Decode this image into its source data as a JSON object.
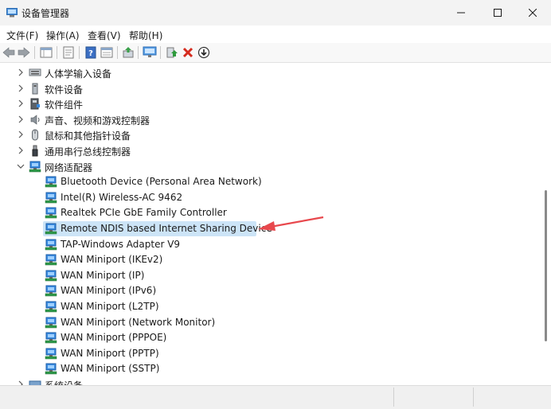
{
  "window": {
    "title": "设备管理器",
    "controls": [
      "minimize",
      "maximize",
      "close"
    ]
  },
  "menu": [
    {
      "label": "文件(F)"
    },
    {
      "label": "操作(A)"
    },
    {
      "label": "查看(V)"
    },
    {
      "label": "帮助(H)"
    }
  ],
  "toolbar": {
    "icons": [
      "back-arrow-icon",
      "forward-arrow-icon",
      "properties-grid-icon",
      "driver-doc-icon",
      "help-icon",
      "view-details-icon",
      "update-driver-icon",
      "monitor-scan-icon",
      "add-driver-icon",
      "uninstall-x-icon",
      "rollback-down-icon"
    ]
  },
  "tree": {
    "items": [
      {
        "label": "人体学输入设备",
        "level": 0,
        "expanded": false,
        "icon": "hid-icon"
      },
      {
        "label": "软件设备",
        "level": 0,
        "expanded": false,
        "icon": "software-device-icon"
      },
      {
        "label": "软件组件",
        "level": 0,
        "expanded": false,
        "icon": "software-component-icon"
      },
      {
        "label": "声音、视频和游戏控制器",
        "level": 0,
        "expanded": false,
        "icon": "speaker-icon"
      },
      {
        "label": "鼠标和其他指针设备",
        "level": 0,
        "expanded": false,
        "icon": "mouse-icon"
      },
      {
        "label": "通用串行总线控制器",
        "level": 0,
        "expanded": false,
        "icon": "usb-icon"
      },
      {
        "label": "网络适配器",
        "level": 0,
        "expanded": true,
        "icon": "network-adapter-icon"
      },
      {
        "label": "Bluetooth Device (Personal Area Network)",
        "level": 1,
        "icon": "network-adapter-icon"
      },
      {
        "label": "Intel(R) Wireless-AC 9462",
        "level": 1,
        "icon": "network-adapter-icon"
      },
      {
        "label": "Realtek PCIe GbE Family Controller",
        "level": 1,
        "icon": "network-adapter-icon"
      },
      {
        "label": "Remote NDIS based Internet Sharing Device",
        "level": 1,
        "icon": "network-adapter-icon",
        "selected": true
      },
      {
        "label": "TAP-Windows Adapter V9",
        "level": 1,
        "icon": "network-adapter-icon"
      },
      {
        "label": "WAN Miniport (IKEv2)",
        "level": 1,
        "icon": "network-adapter-icon"
      },
      {
        "label": "WAN Miniport (IP)",
        "level": 1,
        "icon": "network-adapter-icon"
      },
      {
        "label": "WAN Miniport (IPv6)",
        "level": 1,
        "icon": "network-adapter-icon"
      },
      {
        "label": "WAN Miniport (L2TP)",
        "level": 1,
        "icon": "network-adapter-icon"
      },
      {
        "label": "WAN Miniport (Network Monitor)",
        "level": 1,
        "icon": "network-adapter-icon"
      },
      {
        "label": "WAN Miniport (PPPOE)",
        "level": 1,
        "icon": "network-adapter-icon"
      },
      {
        "label": "WAN Miniport (PPTP)",
        "level": 1,
        "icon": "network-adapter-icon"
      },
      {
        "label": "WAN Miniport (SSTP)",
        "level": 1,
        "icon": "network-adapter-icon"
      },
      {
        "label": "系统设备",
        "level": 0,
        "expanded": false,
        "icon": "system-device-icon"
      }
    ]
  },
  "annotation": {
    "icon": "red-arrow-icon",
    "color": "#e8484d"
  },
  "colors": {
    "selection": "#cce4f7",
    "adapter_blue": "#2f7fd6"
  }
}
